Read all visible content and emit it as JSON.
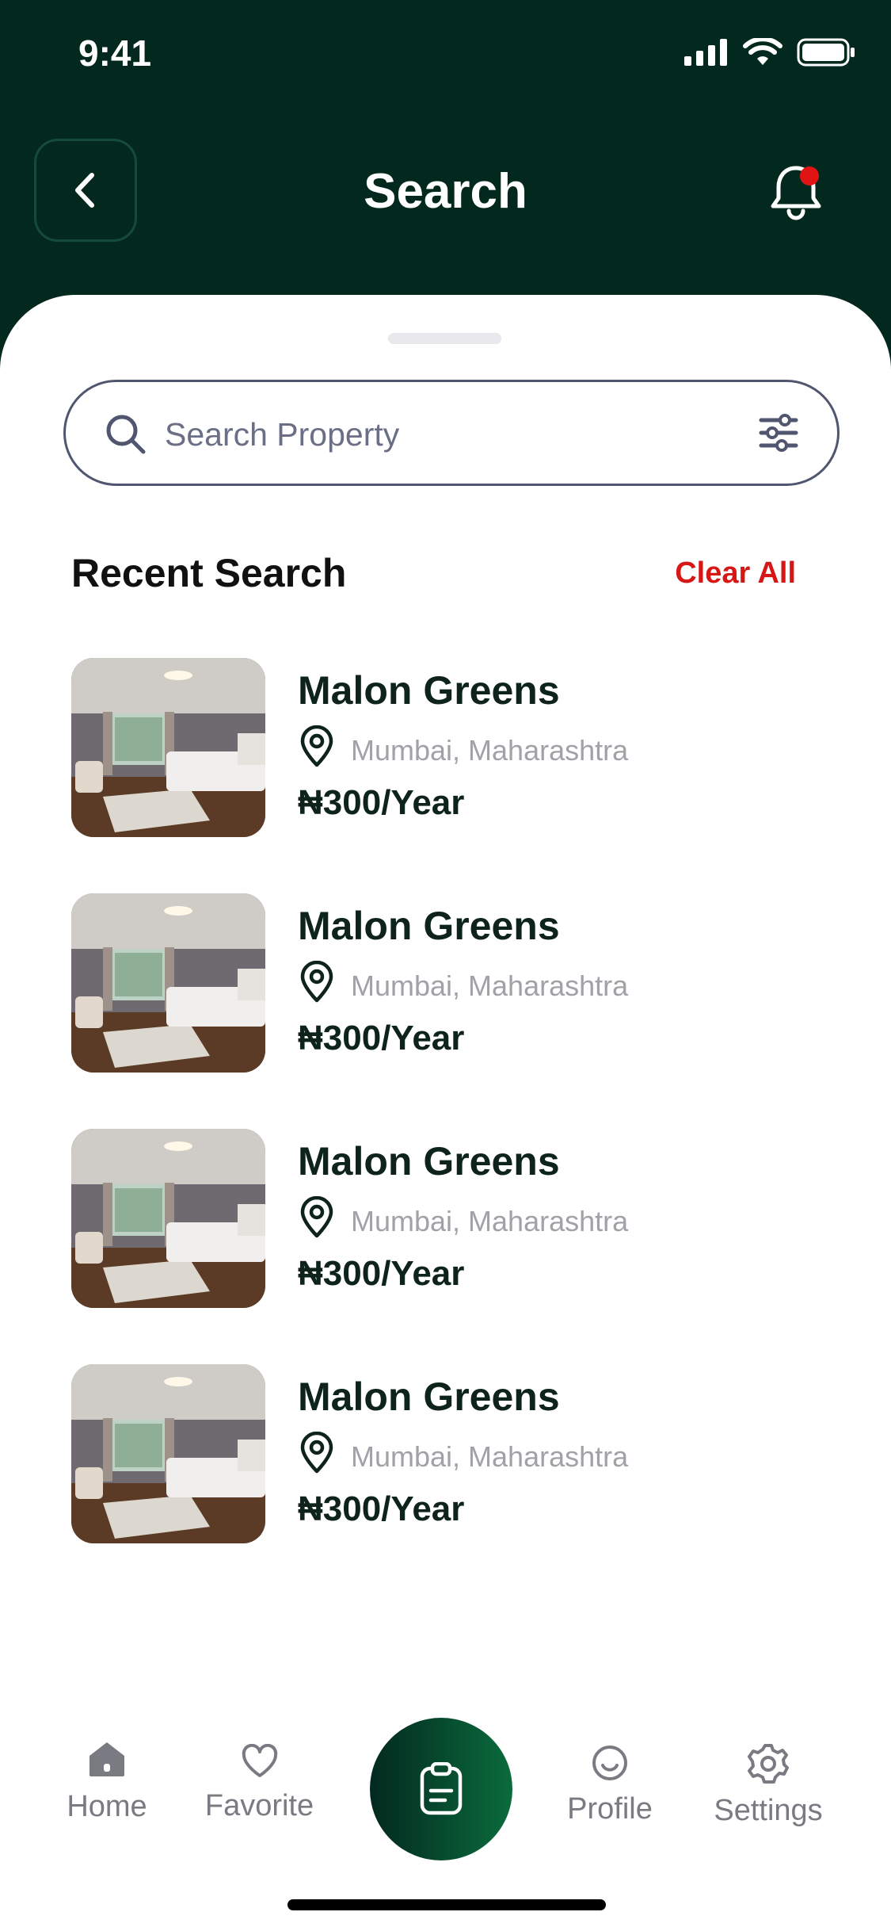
{
  "status_bar": {
    "time": "9:41"
  },
  "header": {
    "title": "Search"
  },
  "search": {
    "placeholder": "Search Property"
  },
  "recent": {
    "title": "Recent Search",
    "clear_label": "Clear All",
    "items": [
      {
        "name": "Malon Greens",
        "location": "Mumbai, Maharashtra",
        "price": "₦300/Year"
      },
      {
        "name": "Malon Greens",
        "location": "Mumbai, Maharashtra",
        "price": "₦300/Year"
      },
      {
        "name": "Malon Greens",
        "location": "Mumbai, Maharashtra",
        "price": "₦300/Year"
      },
      {
        "name": "Malon Greens",
        "location": "Mumbai, Maharashtra",
        "price": "₦300/Year"
      }
    ]
  },
  "nav": {
    "home": "Home",
    "favorite": "Favorite",
    "profile": "Profile",
    "settings": "Settings"
  },
  "colors": {
    "brand": "#03291f",
    "accent": "#d71616"
  }
}
